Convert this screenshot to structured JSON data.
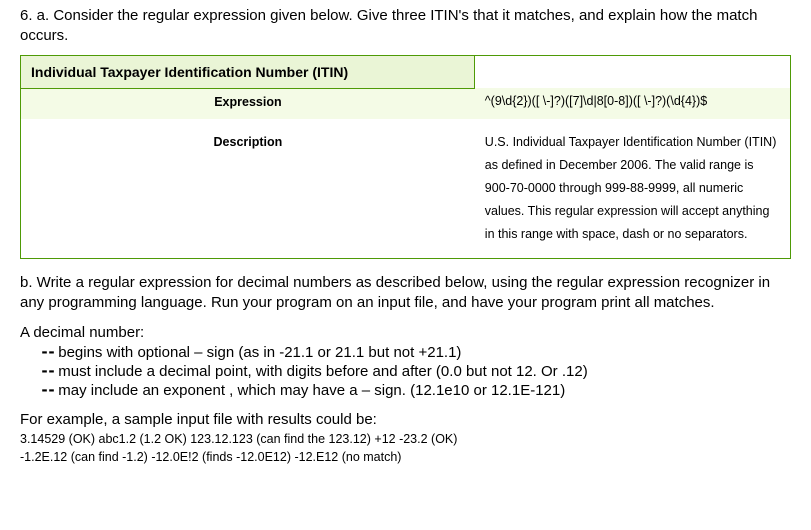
{
  "question": {
    "part_a_intro": "6.  a.   Consider the regular expression given below.   Give three ITIN's that it matches, and explain how the match occurs.",
    "table": {
      "title": "Individual Taxpayer Identification Number (ITIN)",
      "expr_label": "Expression",
      "expr_value": "^(9\\d{2})([ \\-]?)([7]\\d|8[0-8])([ \\-]?)(\\d{4})$",
      "desc_label": "Description",
      "desc_value": "U.S. Individual Taxpayer Identification Number (ITIN) as defined in December 2006. The valid range is 900-70-0000 through 999-88-9999, all numeric values. This regular expression will accept anything in this range with space, dash or no separators."
    },
    "part_b_intro": "b.   Write a regular expression for decimal numbers as described below, using the regular expression recognizer in any programming language.  Run your program on an input file, and have your program print all matches.",
    "list_head": "A decimal number:",
    "bullets": [
      "begins with optional – sign  (as in -21.1 or 21.1 but not +21.1)",
      "must include a decimal point, with digits before and after (0.0 but not 12.  Or .12)",
      "may include an exponent , which may have a – sign.  (12.1e10 or 12.1E-121)"
    ],
    "sample_head": "For example, a sample input file with results could be:",
    "sample_line1": "3.14529 (OK) abc1.2 (1.2 OK) 123.12.123 (can find the 123.12) +12 -23.2 (OK)",
    "sample_line2": "-1.2E.12 (can find -1.2) -12.0E!2 (finds -12.0E12) -12.E12 (no match)"
  }
}
